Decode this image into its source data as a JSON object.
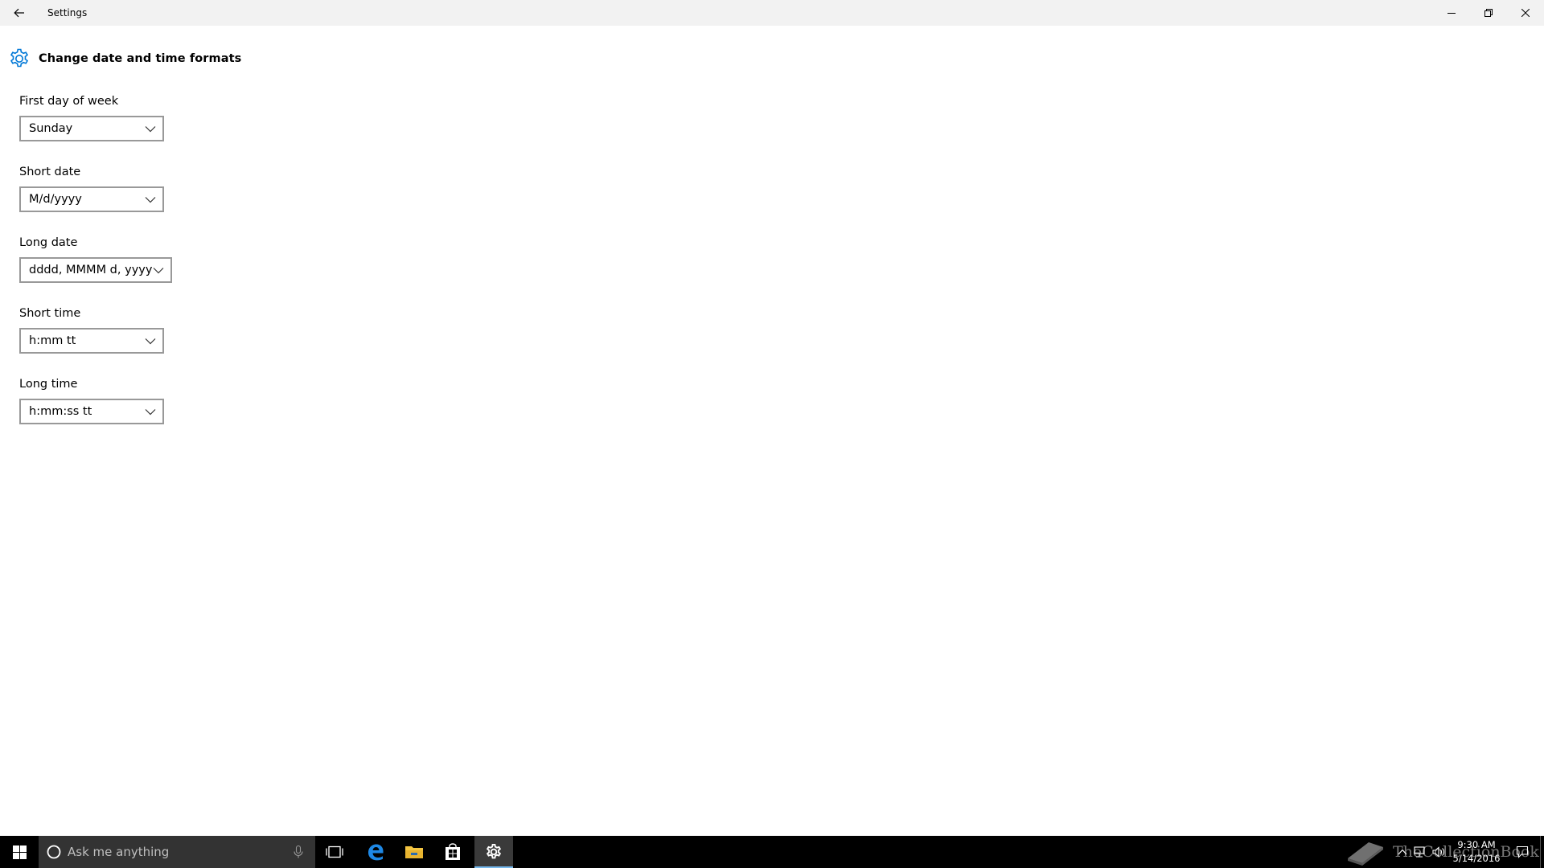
{
  "window": {
    "title": "Settings"
  },
  "page": {
    "title": "Change date and time formats"
  },
  "fields": [
    {
      "label": "First day of week",
      "value": "Sunday"
    },
    {
      "label": "Short date",
      "value": "M/d/yyyy"
    },
    {
      "label": "Long date",
      "value": "dddd, MMMM d, yyyy"
    },
    {
      "label": "Short time",
      "value": "h:mm tt"
    },
    {
      "label": "Long time",
      "value": "h:mm:ss tt"
    }
  ],
  "taskbar": {
    "search_placeholder": "Ask me anything",
    "clock_time": "9:30 AM",
    "clock_date": "5/14/2016",
    "watermark": "TheCollectionBook"
  },
  "colors": {
    "accent": "#0078d7",
    "taskbar_bg": "#000000",
    "titlebar_bg": "#f2f2f2"
  },
  "icons": {
    "back": "back-arrow-icon",
    "settings": "gear-icon",
    "minimize": "minimize-icon",
    "maximize": "restore-icon",
    "close": "close-icon"
  }
}
